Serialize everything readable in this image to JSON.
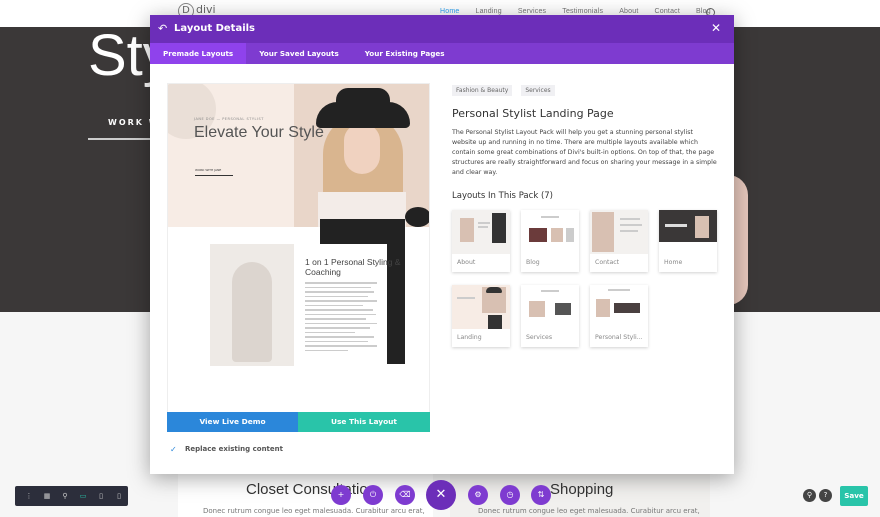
{
  "background": {
    "logo": "divi",
    "menu": [
      "Home",
      "Landing",
      "Services",
      "Testimonials",
      "About",
      "Contact",
      "Blog"
    ],
    "hero_title": "Styl",
    "hero_sub": "WORK WI",
    "cards": [
      {
        "title": "Closet Consultation",
        "text": "Donec rutrum congue leo eget malesuada. Curabitur arcu erat,"
      },
      {
        "title": "Shopping",
        "text": "Donec rutrum congue leo eget malesuada. Curabitur arcu erat,"
      }
    ]
  },
  "modal": {
    "title": "Layout Details",
    "tabs": [
      "Premade Layouts",
      "Your Saved Layouts",
      "Your Existing Pages"
    ],
    "preview": {
      "kicker": "JANE DOE  —  PERSONAL STYLIST",
      "title": "Elevate Your Style",
      "button": "WORK WITH JANE",
      "title2": "1 on 1 Personal Styling & Coaching"
    },
    "view_demo": "View Live Demo",
    "use_layout": "Use This Layout",
    "replace": "Replace existing content",
    "tags": [
      "Fashion & Beauty",
      "Services"
    ],
    "pack_title": "Personal Stylist Landing Page",
    "pack_desc": "The Personal Stylist Layout Pack will help you get a stunning personal stylist website up and running in no time. There are multiple layouts available which contain some great combinations of Divi's built-in options. On top of that, the page structures are really straightforward and focus on sharing your message in a simple and clear way.",
    "layouts_heading": "Layouts In This Pack (7)",
    "layouts": [
      "About",
      "Blog",
      "Contact",
      "Home",
      "Landing",
      "Services",
      "Personal Styli..."
    ]
  },
  "toolbar": {
    "save": "Save"
  },
  "colors": {
    "purple": "#7e3bd0",
    "blue": "#2b87da",
    "teal": "#29c4a9"
  }
}
